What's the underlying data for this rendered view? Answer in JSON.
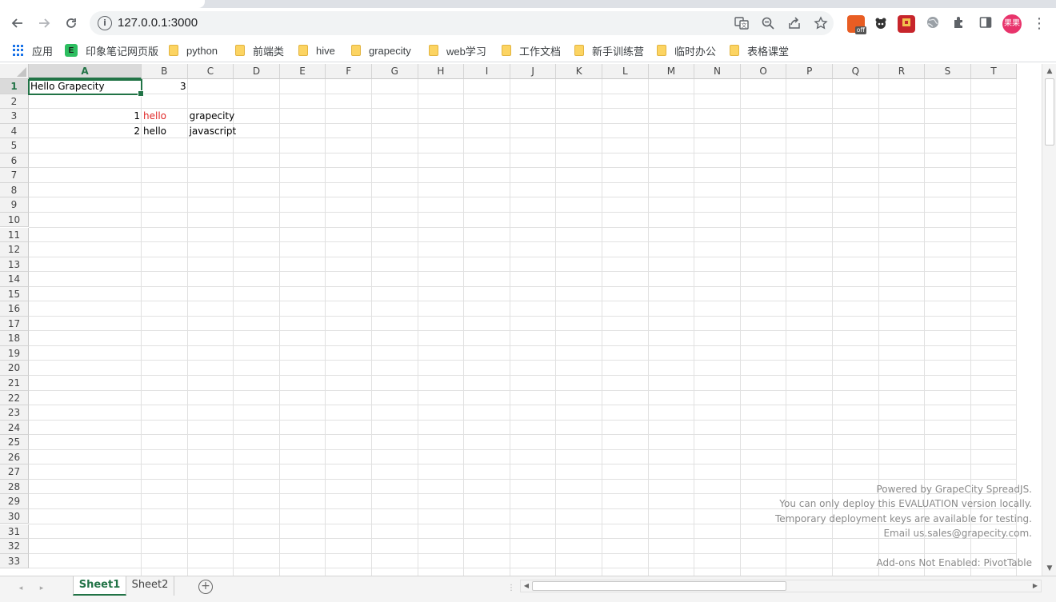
{
  "browser": {
    "url": "127.0.0.1:3000",
    "avatar_text": "果果",
    "extension_off_label": "off"
  },
  "bookmarks": [
    {
      "label": "应用",
      "icon": "apps-grid-icon"
    },
    {
      "label": "印象笔记网页版",
      "icon": "evernote-icon"
    },
    {
      "label": "python",
      "icon": "folder-icon"
    },
    {
      "label": "前端类",
      "icon": "folder-icon"
    },
    {
      "label": "hive",
      "icon": "folder-icon"
    },
    {
      "label": "grapecity",
      "icon": "folder-icon"
    },
    {
      "label": "web学习",
      "icon": "folder-icon"
    },
    {
      "label": "工作文档",
      "icon": "folder-icon"
    },
    {
      "label": "新手训练营",
      "icon": "folder-icon"
    },
    {
      "label": "临时办公",
      "icon": "folder-icon"
    },
    {
      "label": "表格课堂",
      "icon": "folder-icon"
    }
  ],
  "spreadsheet": {
    "columns": [
      "A",
      "B",
      "C",
      "D",
      "E",
      "F",
      "G",
      "H",
      "I",
      "J",
      "K",
      "L",
      "M",
      "N",
      "O",
      "P",
      "Q",
      "R",
      "S",
      "T"
    ],
    "active_column": "A",
    "rows": [
      "1",
      "2",
      "3",
      "4",
      "5",
      "6",
      "7",
      "8",
      "9",
      "10",
      "11",
      "12",
      "13",
      "14",
      "15",
      "16",
      "17",
      "18",
      "19",
      "20",
      "21",
      "22",
      "23",
      "24",
      "25",
      "26",
      "27",
      "28",
      "29",
      "30",
      "31",
      "32",
      "33"
    ],
    "active_row": "1",
    "cells": {
      "A1": "Hello Grapecity",
      "B1": "3",
      "A3": "1",
      "B3": "hello",
      "C3": "grapecity",
      "A4": "2",
      "B4": "hello",
      "C4": "javascript"
    },
    "colors": {
      "B3": "#e02a2a",
      "accent": "#217346"
    },
    "watermark": [
      "Powered by GrapeCity SpreadJS.",
      "You can only deploy this EVALUATION version locally.",
      "Temporary deployment keys are available for testing.",
      "Email us.sales@grapecity.com.",
      "Add-ons Not Enabled: PivotTable"
    ]
  },
  "sheet_tabs": [
    {
      "label": "Sheet1",
      "active": true
    },
    {
      "label": "Sheet2",
      "active": false
    }
  ]
}
